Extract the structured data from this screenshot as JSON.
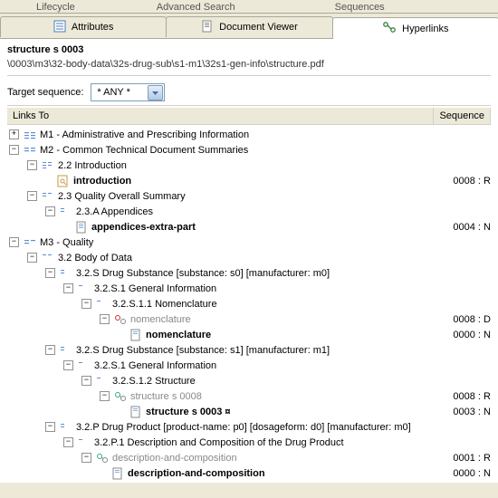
{
  "topcut": {
    "a": "Lifecycle",
    "b": "Advanced Search",
    "c": "Sequences"
  },
  "tabs": {
    "attributes": "Attributes",
    "viewer": "Document Viewer",
    "hyperlinks": "Hyperlinks"
  },
  "title": "structure s 0003",
  "path": "\\0003\\m3\\32-body-data\\32s-drug-sub\\s1-m1\\32s1-gen-info\\structure.pdf",
  "target": {
    "label": "Target sequence:",
    "value": "* ANY *"
  },
  "cols": {
    "links": "Links To",
    "seq": "Sequence"
  },
  "tree": {
    "m1": "M1 - Administrative and Prescribing Information",
    "m2": "M2 - Common Technical Document Summaries",
    "s22": "2.2 Introduction",
    "intro": "introduction",
    "intro_seq": "0008 : R",
    "s23": "2.3 Quality Overall Summary",
    "s23a": "2.3.A Appendices",
    "appx": "appendices-extra-part",
    "appx_seq": "0004 : N",
    "m3": "M3 - Quality",
    "s32": "3.2 Body of Data",
    "s32s0": "3.2.S Drug Substance [substance: s0] [manufacturer: m0]",
    "s32s1gi0": "3.2.S.1 General Information",
    "s32s11": "3.2.S.1.1 Nomenclature",
    "nom_dim": "nomenclature",
    "nom_dim_seq": "0008 : D",
    "nom": "nomenclature",
    "nom_seq": "0000 : N",
    "s32s1": "3.2.S Drug Substance [substance: s1] [manufacturer: m1]",
    "s32s1gi1": "3.2.S.1 General Information",
    "s32s12": "3.2.S.1.2 Structure",
    "str8": "structure s 0008",
    "str8_seq": "0008 : R",
    "str3": "structure s 0003 ¤",
    "str3_seq": "0003 : N",
    "s32p": "3.2.P Drug Product [product-name: p0] [dosageform: d0] [manufacturer: m0]",
    "s32p1": "3.2.P.1 Description and Composition of the Drug Product",
    "desc_dim": "description-and-composition",
    "desc_dim_seq": "0001 : R",
    "desc": "description-and-composition",
    "desc_seq": "0000 : N"
  }
}
